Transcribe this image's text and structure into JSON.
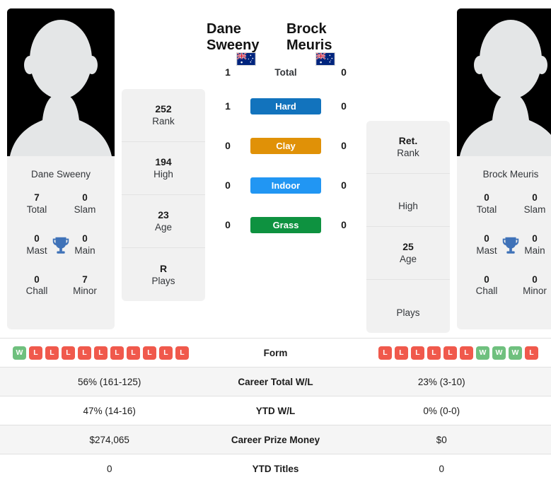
{
  "players": {
    "left": {
      "name": "Dane Sweeny",
      "card_name": "Dane Sweeny",
      "flag": "australia-flag",
      "trophies": {
        "total": "7",
        "total_label": "Total",
        "slam": "0",
        "slam_label": "Slam",
        "mast": "0",
        "mast_label": "Mast",
        "main": "0",
        "main_label": "Main",
        "chall": "0",
        "chall_label": "Chall",
        "minor": "7",
        "minor_label": "Minor"
      },
      "rank": "252",
      "high": "194",
      "age": "23",
      "plays": "R"
    },
    "right": {
      "name": "Brock Meuris",
      "card_name": "Brock Meuris",
      "flag": "australia-flag",
      "trophies": {
        "total": "0",
        "total_label": "Total",
        "slam": "0",
        "slam_label": "Slam",
        "mast": "0",
        "mast_label": "Mast",
        "main": "0",
        "main_label": "Main",
        "chall": "0",
        "chall_label": "Chall",
        "minor": "0",
        "minor_label": "Minor"
      },
      "rank": "Ret.",
      "high": "",
      "age": "25",
      "plays": ""
    }
  },
  "rank_labels": {
    "rank": "Rank",
    "high": "High",
    "age": "Age",
    "plays": "Plays"
  },
  "h2h": [
    {
      "key": "total",
      "label": "Total",
      "left": "1",
      "right": "0",
      "color": null
    },
    {
      "key": "hard",
      "label": "Hard",
      "left": "1",
      "right": "0",
      "color": "#1273bd"
    },
    {
      "key": "clay",
      "label": "Clay",
      "left": "0",
      "right": "0",
      "color": "#e09107"
    },
    {
      "key": "indoor",
      "label": "Indoor",
      "left": "0",
      "right": "0",
      "color": "#2196f3"
    },
    {
      "key": "grass",
      "label": "Grass",
      "left": "0",
      "right": "0",
      "color": "#0e9240"
    }
  ],
  "form": {
    "label": "Form",
    "left": [
      "W",
      "L",
      "L",
      "L",
      "L",
      "L",
      "L",
      "L",
      "L",
      "L",
      "L"
    ],
    "right": [
      "L",
      "L",
      "L",
      "L",
      "L",
      "L",
      "W",
      "W",
      "W",
      "L"
    ]
  },
  "stats_rows": [
    {
      "label": "Career Total W/L",
      "left": "56% (161-125)",
      "right": "23% (3-10)"
    },
    {
      "label": "YTD W/L",
      "left": "47% (14-16)",
      "right": "0% (0-0)"
    },
    {
      "label": "Career Prize Money",
      "left": "$274,065",
      "right": "$0"
    },
    {
      "label": "YTD Titles",
      "left": "0",
      "right": "0"
    }
  ],
  "colors": {
    "win": "#6fc07e",
    "loss": "#f0594c",
    "card_bg": "#f1f1f1",
    "photo_bg": "#000000"
  }
}
